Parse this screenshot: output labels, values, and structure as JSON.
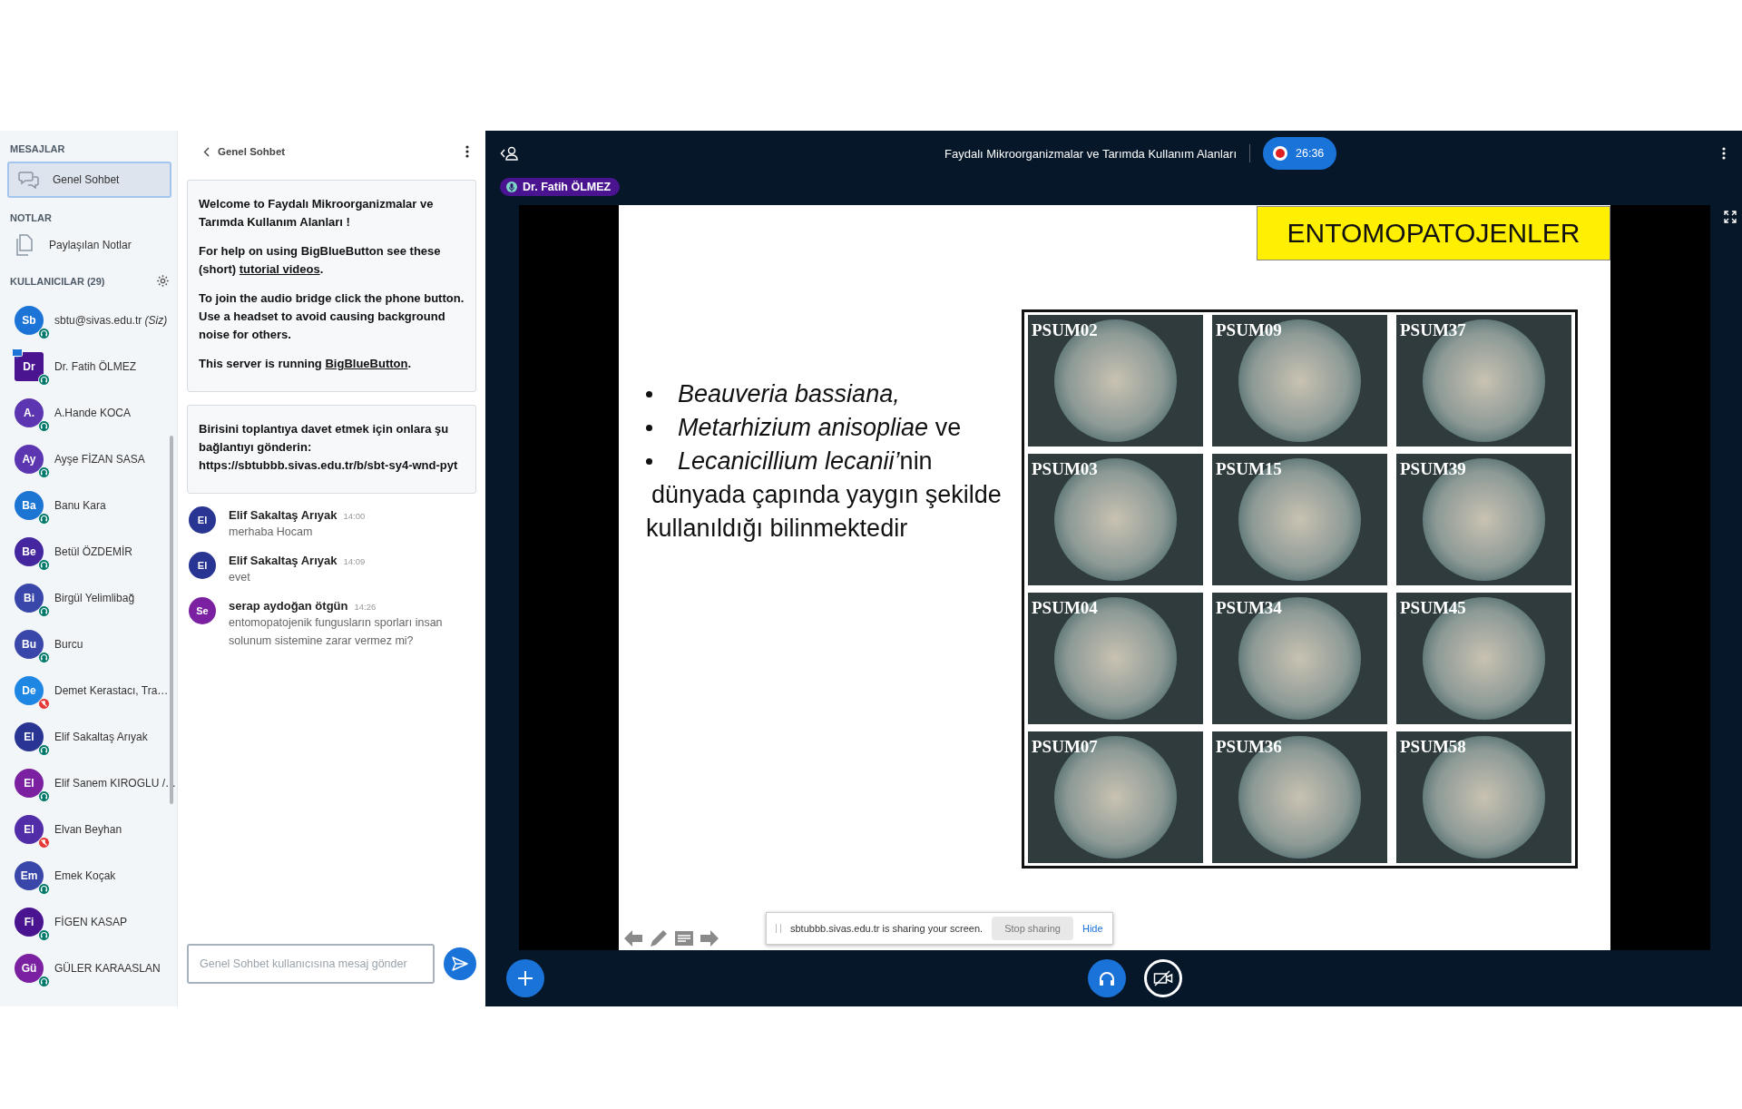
{
  "sidebar": {
    "messages_heading": "MESAJLAR",
    "chat_item": {
      "label": "Genel Sohbet",
      "selected": true
    },
    "notes_heading": "NOTLAR",
    "notes_item": "Paylaşılan Notlar",
    "users_heading": "KULLANICILAR (29)",
    "users": [
      {
        "initials": "Sb",
        "name": "sbtu@sivas.edu.tr *(Siz)*",
        "color": "#1b74d6",
        "presenter": false,
        "kind": "listen"
      },
      {
        "initials": "Dr",
        "name": "Dr. Fatih ÖLMEZ",
        "color": "#4a1490",
        "presenter": true,
        "kind": "listen"
      },
      {
        "initials": "A.",
        "name": "A.Hande KOCA",
        "color": "#5b36b0",
        "presenter": false,
        "kind": "listen"
      },
      {
        "initials": "Ay",
        "name": "Ayşe FİZAN SASA",
        "color": "#5b36b0",
        "presenter": false,
        "kind": "listen"
      },
      {
        "initials": "Ba",
        "name": "Banu Kara",
        "color": "#1c75d2",
        "presenter": false,
        "kind": "listen"
      },
      {
        "initials": "Be",
        "name": "Betül ÖZDEMİR",
        "color": "#44279e",
        "presenter": false,
        "kind": "listen"
      },
      {
        "initials": "Bi",
        "name": "Birgül Yelimlibağ",
        "color": "#3a47aa",
        "presenter": false,
        "kind": "listen"
      },
      {
        "initials": "Bu",
        "name": "Burcu",
        "color": "#3a47aa",
        "presenter": false,
        "kind": "listen"
      },
      {
        "initials": "De",
        "name": "Demet Kerastacı, Tra…",
        "color": "#1e86e3",
        "presenter": false,
        "kind": "muted"
      },
      {
        "initials": "El",
        "name": "Elif Sakaltaş Arıyak",
        "color": "#283593",
        "presenter": false,
        "kind": "listen"
      },
      {
        "initials": "El",
        "name": "Elif Sanem KIROGLU /…",
        "color": "#7a20a0",
        "presenter": false,
        "kind": "listen"
      },
      {
        "initials": "El",
        "name": "Elvan Beyhan",
        "color": "#512da8",
        "presenter": false,
        "kind": "muted"
      },
      {
        "initials": "Em",
        "name": "Emek Koçak",
        "color": "#3a47aa",
        "presenter": false,
        "kind": "listen"
      },
      {
        "initials": "Fi",
        "name": "FİGEN KASAP",
        "color": "#4a1490",
        "presenter": false,
        "kind": "listen"
      },
      {
        "initials": "Gü",
        "name": "GÜLER KARAASLAN",
        "color": "#7a20a0",
        "presenter": false,
        "kind": "listen"
      }
    ]
  },
  "chat": {
    "title": "Genel Sohbet",
    "welcome": [
      "**Welcome to Faydalı Mikroorganizmalar ve Tarımda Kullanım Alanları !**"
    ],
    "help_text": "For help on using BigBlueButton see these (short)",
    "help_link": "tutorial videos",
    "help_end": ".",
    "audio_text": "To join the audio bridge click the phone button. Use a headset to avoid causing background noise for others.",
    "server_text": "This server is running",
    "server_link": "BigBlueButton",
    "server_end": ".",
    "invite": "Birisini toplantıya davet etmek için onlara şu bağlantıyı gönderin: https://sbtubbb.sivas.edu.tr/b/sbt-sy4-wnd-pyt",
    "messages": [
      {
        "initials": "El",
        "color": "#283593",
        "author": "Elif Sakaltaş Arıyak",
        "time": "14:00",
        "text": "merhaba Hocam"
      },
      {
        "initials": "El",
        "color": "#283593",
        "author": "Elif Sakaltaş Arıyak",
        "time": "14:09",
        "text": "evet"
      },
      {
        "initials": "Se",
        "color": "#7a20a0",
        "author": "serap aydoğan ötgün",
        "time": "14:26",
        "text": "entomopatojenik fungusların sporları insan solunum sistemine zarar vermez mi?"
      }
    ],
    "input": {
      "placeholder": "Genel Sohbet kullanıcısına mesaj gönder"
    }
  },
  "meeting": {
    "title": "Faydalı Mikroorganizmalar ve Tarımda Kullanım Alanları",
    "recording": true,
    "timer": "26:36",
    "presenter_badge": "Dr. Fatih ÖLMEZ"
  },
  "slide": {
    "title": "ENTOMOPATOJENLER",
    "bullets": [
      {
        "italic": "Beauveria bassiana,"
      },
      {
        "italic": "Metarhizium anisopliae",
        "plain": " ve"
      },
      {
        "italic": "Lecanicillium lecanii’",
        "plain": "nin"
      }
    ],
    "body": [
      "dünyada çapında yaygın şekilde",
      "kullanıldığı  bilinmektedir"
    ],
    "plates": [
      "PSUM02",
      "PSUM09",
      "PSUM37",
      "PSUM03",
      "PSUM15",
      "PSUM39",
      "PSUM04",
      "PSUM34",
      "PSUM45",
      "PSUM07",
      "PSUM36",
      "PSUM58"
    ]
  },
  "share_bar": {
    "text": "sbtubbb.sivas.edu.tr is sharing your screen.",
    "stop": "Stop sharing",
    "hide": "Hide"
  }
}
